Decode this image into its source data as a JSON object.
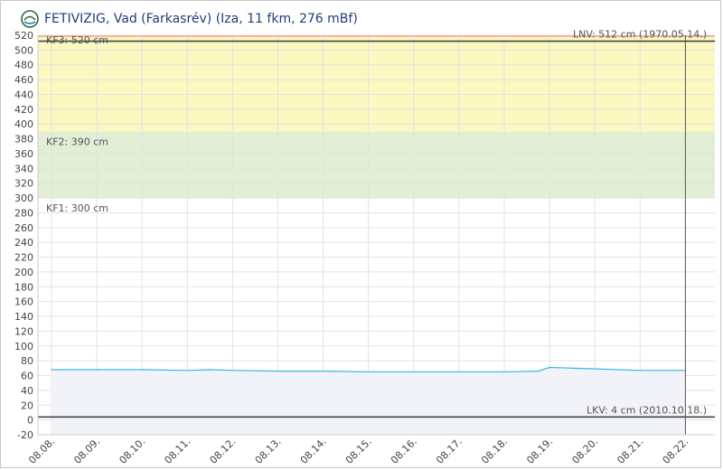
{
  "header": {
    "title": "FETIVIZIG, Vad (Farkasrév) (Iza, 11 fkm, 276 mBf)",
    "logo_icon": "drop-logo-icon"
  },
  "chart_data": {
    "type": "area",
    "title": "FETIVIZIG, Vad (Farkasrév) (Iza, 11 fkm, 276 mBf)",
    "xlabel": "",
    "ylabel": "",
    "ylim": [
      -20,
      520
    ],
    "yticks": [
      -20,
      0,
      20,
      40,
      60,
      80,
      100,
      120,
      140,
      160,
      180,
      200,
      220,
      240,
      260,
      280,
      300,
      320,
      340,
      360,
      380,
      400,
      420,
      440,
      460,
      480,
      500,
      520
    ],
    "xlim": [
      "2025-08-08",
      "2025-08-22"
    ],
    "xticks": [
      "08.08.",
      "08.09.",
      "08.10.",
      "08.11.",
      "08.12.",
      "08.13.",
      "08.14.",
      "08.15.",
      "08.16.",
      "08.17.",
      "08.18.",
      "08.19.",
      "08.20.",
      "08.21.",
      "08.22."
    ],
    "grid": true,
    "bands": [
      {
        "from": 300,
        "to": 390,
        "color": "#e2efd5"
      },
      {
        "from": 390,
        "to": 520,
        "color": "#fbf8c0"
      }
    ],
    "levels": [
      {
        "label": "KF3: 520 cm",
        "value": 520,
        "color": "#f4b6a2"
      },
      {
        "label": "KF2: 390 cm",
        "value": 390,
        "color": "#e2efd5"
      },
      {
        "label": "KF1: 300 cm",
        "value": 300,
        "color": "#e2efd5"
      },
      {
        "label": "LNV: 512 cm (1970.05.14.)",
        "value": 512,
        "color": "#444444"
      },
      {
        "label": "LKV: 4 cm (2010.10.18.)",
        "value": 4,
        "color": "#444444"
      }
    ],
    "series": [
      {
        "color": "#38b6e6",
        "x": [
          "08.08.",
          "08.09.",
          "08.10.",
          "08.11.",
          "08.11. 12h",
          "08.12.",
          "08.13.",
          "08.14.",
          "08.15.",
          "08.16.",
          "08.17.",
          "08.18.",
          "08.18. 18h",
          "08.19.",
          "08.19. 12h",
          "08.20.",
          "08.21.",
          "08.22."
        ],
        "values": [
          68,
          68,
          68,
          67,
          68,
          67,
          66,
          66,
          65,
          65,
          65,
          65,
          66,
          71,
          70,
          69,
          67,
          67
        ]
      }
    ],
    "current_marker": "08.22."
  },
  "colors": {
    "title": "#1f3c7a",
    "grid": "#e3e3e3",
    "axis_text": "#444444",
    "area_fill": "#f2f3f9",
    "band_text": "#555555"
  }
}
